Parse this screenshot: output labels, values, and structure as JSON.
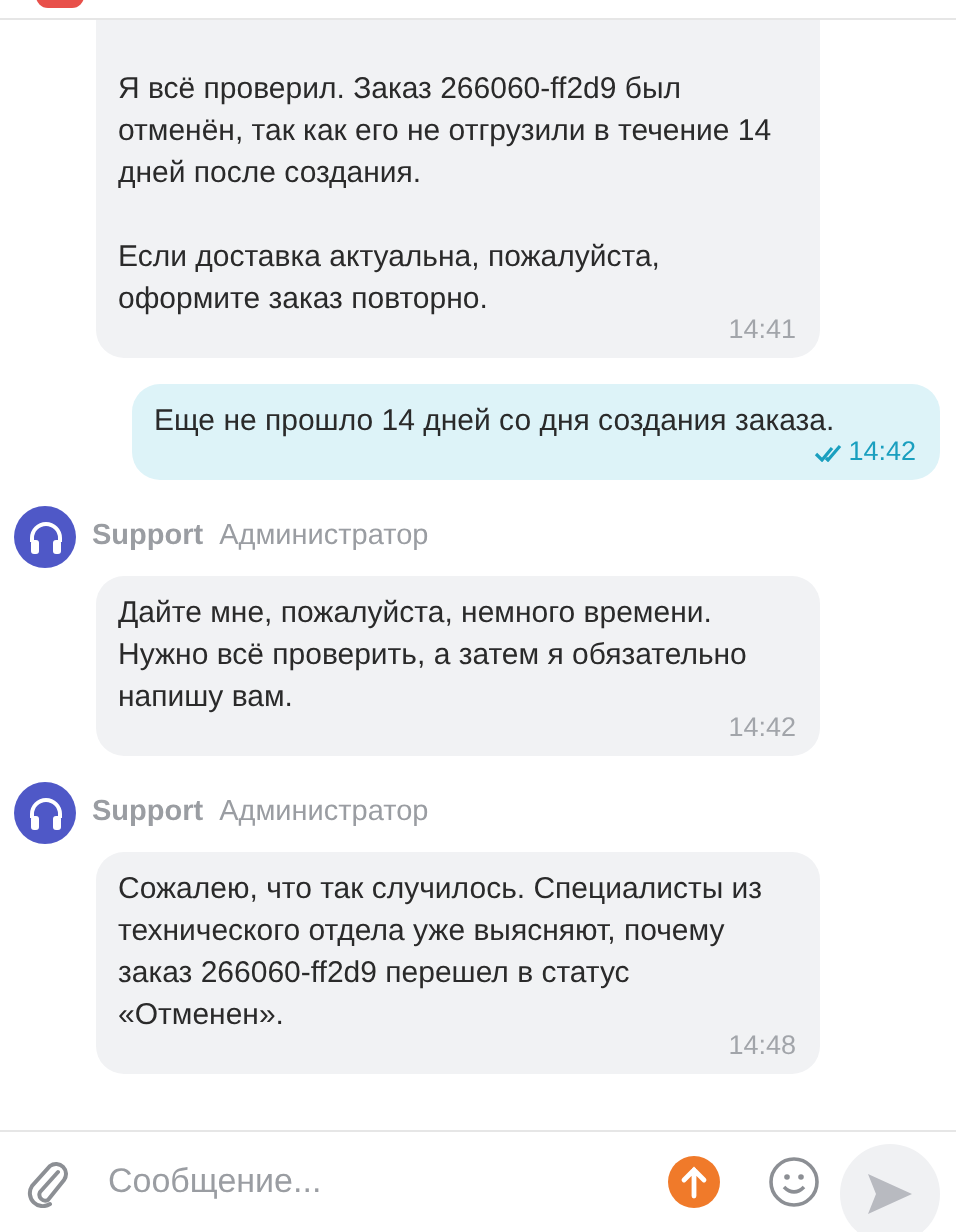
{
  "messages": [
    {
      "kind": "incoming",
      "paragraphs": [
        "Я всё проверил. Заказ 266060-ff2d9 был отменён, так как его не отгрузили в течение 14 дней после создания.",
        "Если доставка актуальна, пожалуйста, оформите заказ повторно."
      ],
      "time": "14:41"
    },
    {
      "kind": "outgoing",
      "paragraphs": [
        "Еще не прошло 14 дней со дня создания заказа."
      ],
      "time": "14:42",
      "read": true
    },
    {
      "kind": "incoming",
      "sender": "Support",
      "role": "Администратор",
      "paragraphs": [
        "Дайте мне, пожалуйста, немного времени. Нужно всё проверить, а затем я обязательно напишу вам."
      ],
      "time": "14:42"
    },
    {
      "kind": "incoming",
      "sender": "Support",
      "role": "Администратор",
      "paragraphs": [
        "Сожалею, что так случилось. Специалисты из технического отдела уже выясняют, почему заказ 266060-ff2d9 перешел в статус «Отменен»."
      ],
      "time": "14:48"
    }
  ],
  "composer": {
    "placeholder": "Сообщение..."
  }
}
